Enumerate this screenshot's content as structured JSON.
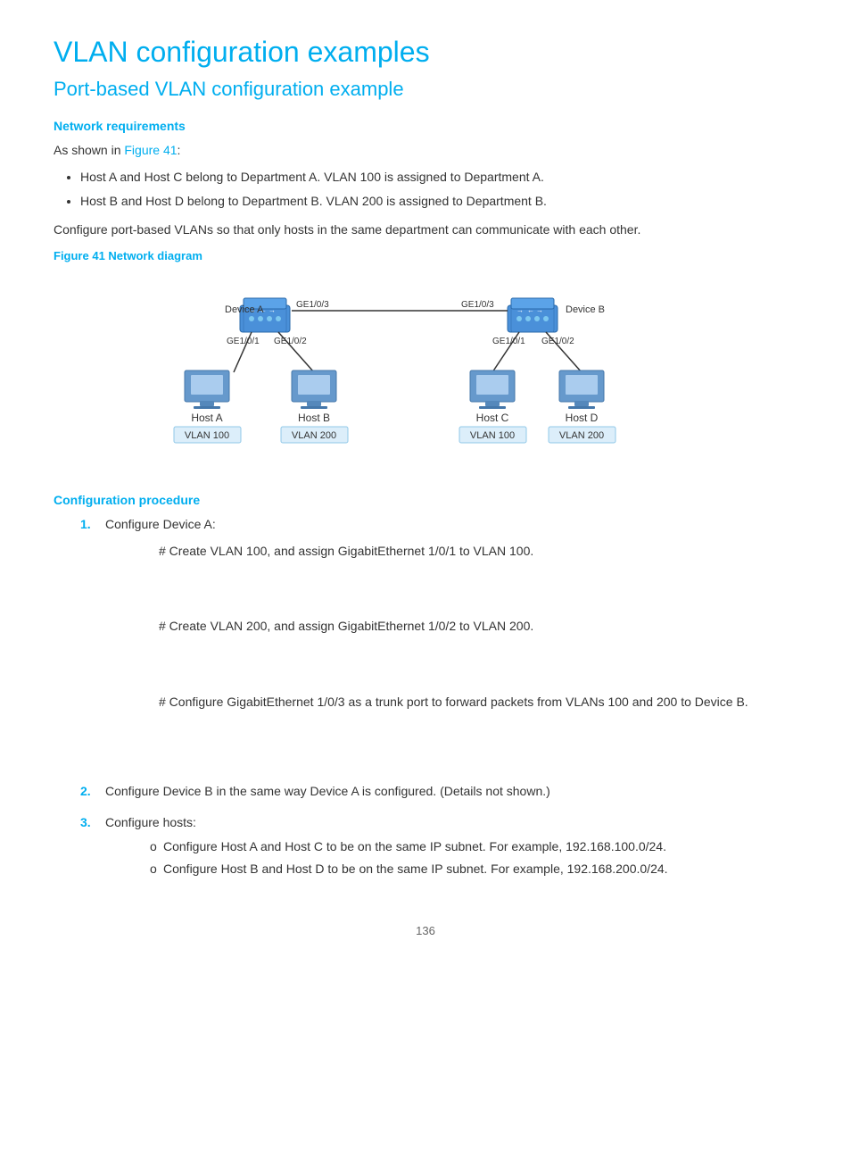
{
  "page": {
    "title": "VLAN configuration examples",
    "subtitle": "Port-based VLAN configuration example",
    "sections": {
      "network_requirements": {
        "heading": "Network requirements",
        "intro": "As shown in Figure 41:",
        "figure_link": "Figure 41",
        "bullets": [
          "Host A and Host C belong to Department A. VLAN 100 is assigned to Department A.",
          "Host B and Host D belong to Department B. VLAN 200 is assigned to Department B."
        ],
        "configure_text": "Configure port-based VLANs so that only hosts in the same department can communicate with each other.",
        "figure_label": "Figure 41 Network diagram"
      },
      "configuration_procedure": {
        "heading": "Configuration procedure",
        "steps": [
          {
            "label": "1.",
            "text": "Configure Device A:",
            "sub_steps": [
              "# Create VLAN 100, and assign GigabitEthernet 1/0/1 to VLAN 100.",
              "# Create VLAN 200, and assign GigabitEthernet 1/0/2 to VLAN 200.",
              "# Configure GigabitEthernet 1/0/3 as a trunk port to forward packets from VLANs 100 and 200 to Device B."
            ]
          },
          {
            "label": "2.",
            "text": "Configure Device B in the same way Device A is configured. (Details not shown.)"
          },
          {
            "label": "3.",
            "text": "Configure hosts:",
            "sub_items": [
              "Configure Host A and Host C to be on the same IP subnet. For example,  192.168.100.0/24.",
              "Configure Host B and Host D to be on the same IP subnet. For example,  192.168.200.0/24."
            ]
          }
        ]
      }
    },
    "diagram": {
      "device_a": {
        "label": "Device A",
        "ports": [
          "GE1/0/3",
          "GE1/0/1",
          "GE1/0/2"
        ]
      },
      "device_b": {
        "label": "Device B",
        "ports": [
          "GE1/0/3",
          "GE1/0/1",
          "GE1/0/2"
        ]
      },
      "hosts_left": [
        {
          "label": "Host A",
          "vlan": "VLAN 100"
        },
        {
          "label": "Host B",
          "vlan": "VLAN 200"
        }
      ],
      "hosts_right": [
        {
          "label": "Host C",
          "vlan": "VLAN 100"
        },
        {
          "label": "Host D",
          "vlan": "VLAN 200"
        }
      ]
    },
    "page_number": "136"
  }
}
